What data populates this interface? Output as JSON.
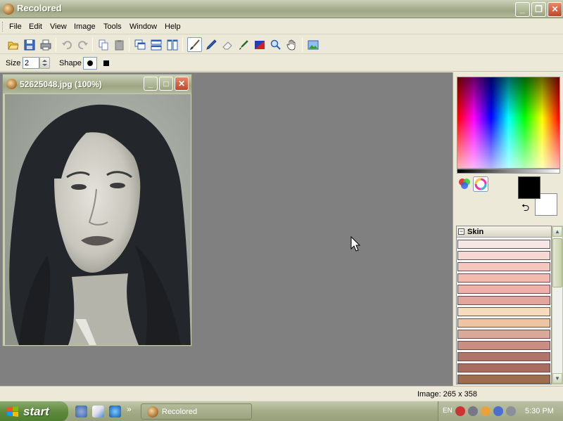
{
  "window": {
    "title": "Recolored"
  },
  "menu": [
    "File",
    "Edit",
    "View",
    "Image",
    "Tools",
    "Window",
    "Help"
  ],
  "options": {
    "size_label": "Size",
    "size_value": "2",
    "shape_label": "Shape"
  },
  "image_window": {
    "title": "52625048.jpg (100%)"
  },
  "palette": {
    "group_title": "Skin",
    "colors": [
      "#f6e6e4",
      "#f5d8d2",
      "#f3c7be",
      "#f1bbb0",
      "#eeb0a8",
      "#e2a69d",
      "#f6dcbc",
      "#eec5a4",
      "#d9a898",
      "#c98d82",
      "#b17469",
      "#a96c60",
      "#9d6d4e"
    ]
  },
  "status": {
    "image_info": "Image: 265 x 358"
  },
  "taskbar": {
    "start_label": "start",
    "task_label": "Recolored",
    "language": "EN",
    "clock": "5:30 PM",
    "chevron": "»"
  }
}
